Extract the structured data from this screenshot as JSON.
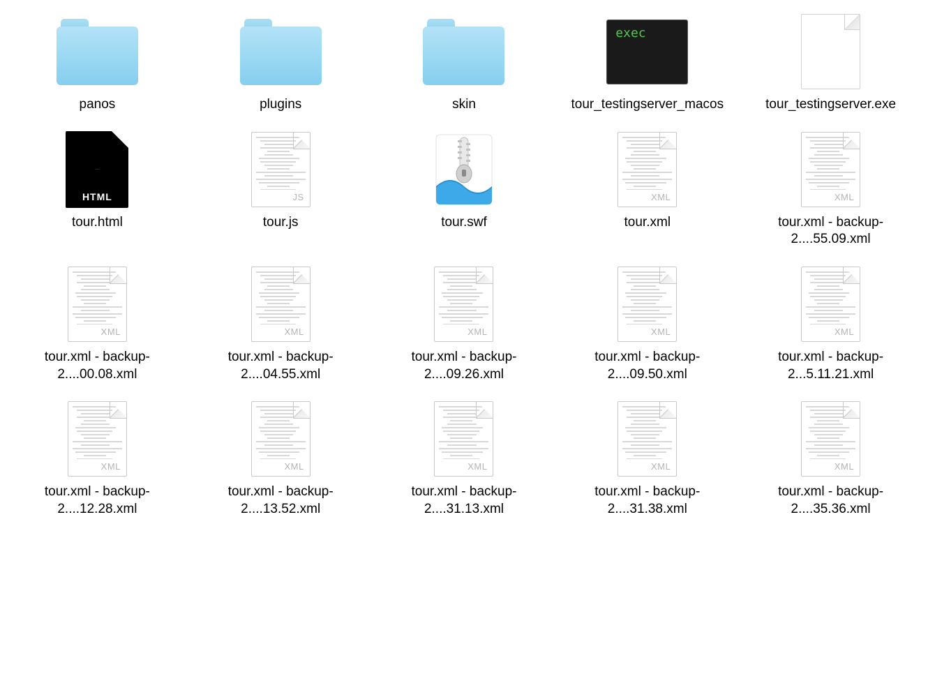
{
  "items": [
    {
      "name": "panos",
      "type": "folder"
    },
    {
      "name": "plugins",
      "type": "folder"
    },
    {
      "name": "skin",
      "type": "folder"
    },
    {
      "name": "tour_testingserver_macos",
      "type": "exec",
      "execText": "exec"
    },
    {
      "name": "tour_testingserver.exe",
      "type": "blank"
    },
    {
      "name": "tour.html",
      "type": "html",
      "badge": "HTML"
    },
    {
      "name": "tour.js",
      "type": "code",
      "badge": "JS"
    },
    {
      "name": "tour.swf",
      "type": "swf"
    },
    {
      "name": "tour.xml",
      "type": "code",
      "badge": "XML"
    },
    {
      "name": "tour.xml - backup-2....55.09.xml",
      "type": "code",
      "badge": "XML"
    },
    {
      "name": "tour.xml - backup-2....00.08.xml",
      "type": "code",
      "badge": "XML"
    },
    {
      "name": "tour.xml - backup-2....04.55.xml",
      "type": "code",
      "badge": "XML"
    },
    {
      "name": "tour.xml - backup-2....09.26.xml",
      "type": "code",
      "badge": "XML"
    },
    {
      "name": "tour.xml - backup-2....09.50.xml",
      "type": "code",
      "badge": "XML"
    },
    {
      "name": "tour.xml - backup-2...5.11.21.xml",
      "type": "code",
      "badge": "XML"
    },
    {
      "name": "tour.xml - backup-2....12.28.xml",
      "type": "code",
      "badge": "XML"
    },
    {
      "name": "tour.xml - backup-2....13.52.xml",
      "type": "code",
      "badge": "XML"
    },
    {
      "name": "tour.xml - backup-2....31.13.xml",
      "type": "code",
      "badge": "XML"
    },
    {
      "name": "tour.xml - backup-2....31.38.xml",
      "type": "code",
      "badge": "XML"
    },
    {
      "name": "tour.xml - backup-2....35.36.xml",
      "type": "code",
      "badge": "XML"
    }
  ]
}
